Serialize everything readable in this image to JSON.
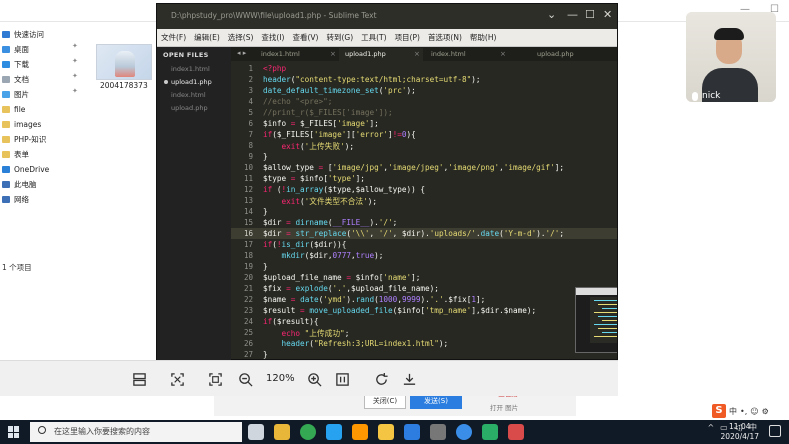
{
  "explorer": {
    "nav": [
      {
        "label": "快速访问",
        "color": "#2f7bd3",
        "pinned": false
      },
      {
        "label": "桌面",
        "color": "#3a8fe0",
        "pinned": true
      },
      {
        "label": "下载",
        "color": "#2e8de0",
        "pinned": true
      },
      {
        "label": "文档",
        "color": "#9aa6b2",
        "pinned": true
      },
      {
        "label": "图片",
        "color": "#4aa3e8",
        "pinned": true
      },
      {
        "label": "file",
        "color": "#e8c25a",
        "pinned": false
      },
      {
        "label": "images",
        "color": "#e8c25a",
        "pinned": false
      },
      {
        "label": "PHP-知识",
        "color": "#e8c25a",
        "pinned": false
      },
      {
        "label": "表单",
        "color": "#e8c25a",
        "pinned": false
      },
      {
        "label": "OneDrive",
        "color": "#2a7fd6",
        "pinned": false
      },
      {
        "label": "此电脑",
        "color": "#3d6fb6",
        "pinned": false
      },
      {
        "label": "网络",
        "color": "#3d6fb6",
        "pinned": false
      }
    ],
    "thumbnail_label": "2004178373",
    "status": "1 个项目",
    "dialog": {
      "close_label": "关闭(C)",
      "send_label": "发送(S)",
      "chip_top": "06主石路",
      "chip_bottom": "打开 图片"
    }
  },
  "sublime": {
    "title": "D:\\phpstudy_pro\\WWW\\file\\upload1.php - Sublime Text",
    "menu": [
      "文件(F)",
      "编辑(E)",
      "选择(S)",
      "查找(I)",
      "查看(V)",
      "转到(G)",
      "工具(T)",
      "项目(P)",
      "首选项(N)",
      "帮助(H)"
    ],
    "sidebar_header": "OPEN FILES",
    "open_files": [
      "index1.html",
      "upload1.php",
      "index.html",
      "upload.php"
    ],
    "tabs": [
      "index1.html",
      "upload1.php",
      "index.html",
      "upload.php"
    ],
    "current_line": 16,
    "code": [
      {
        "n": "1",
        "html": "<span style=\"color:#f92672\">&lt;?php</span>"
      },
      {
        "n": "2",
        "html": "<span style=\"color:#66d9ef\">header</span>(<span style=\"color:#e6db74\">\"content-type:text/html;charset=utf-8\"</span>);"
      },
      {
        "n": "3",
        "html": "<span style=\"color:#66d9ef\">date_default_timezone_set</span>(<span style=\"color:#e6db74\">'prc'</span>);"
      },
      {
        "n": "4",
        "html": "<span style=\"color:#75715e\">//echo \"&lt;pre&gt;\";</span>"
      },
      {
        "n": "5",
        "html": "<span style=\"color:#75715e\">//print_r($_FILES['image']);</span>"
      },
      {
        "n": "6",
        "html": "$info <span style=\"color:#f92672\">=</span> $_FILES[<span style=\"color:#e6db74\">'image'</span>];"
      },
      {
        "n": "7",
        "html": "<span style=\"color:#f92672\">if</span>($_FILES[<span style=\"color:#e6db74\">'image'</span>][<span style=\"color:#e6db74\">'error'</span>]<span style=\"color:#f92672\">!=</span><span style=\"color:#ae81ff\">0</span>){"
      },
      {
        "n": "8",
        "html": "    <span style=\"color:#f92672\">exit</span>(<span style=\"color:#e6db74\">'上传失败'</span>);"
      },
      {
        "n": "9",
        "html": "}"
      },
      {
        "n": "10",
        "html": "$allow_type <span style=\"color:#f92672\">=</span> [<span style=\"color:#e6db74\">'image/jpg'</span>,<span style=\"color:#e6db74\">'image/jpeg'</span>,<span style=\"color:#e6db74\">'image/png'</span>,<span style=\"color:#e6db74\">'image/gif'</span>];"
      },
      {
        "n": "11",
        "html": "$type <span style=\"color:#f92672\">=</span> $info[<span style=\"color:#e6db74\">'type'</span>];"
      },
      {
        "n": "12",
        "html": "<span style=\"color:#f92672\">if</span> (<span style=\"color:#f92672\">!</span><span style=\"color:#66d9ef\">in_array</span>($type,$allow_type)) {"
      },
      {
        "n": "13",
        "html": "    <span style=\"color:#f92672\">exit</span>(<span style=\"color:#e6db74\">'文件类型不合法'</span>);"
      },
      {
        "n": "14",
        "html": "}"
      },
      {
        "n": "15",
        "html": "$dir <span style=\"color:#f92672\">=</span> <span style=\"color:#66d9ef\">dirname</span>(<span style=\"color:#ae81ff\">__FILE__</span>).<span style=\"color:#e6db74\">'/'</span>;"
      },
      {
        "n": "16",
        "html": "$dir <span style=\"color:#f92672\">=</span> <span style=\"color:#66d9ef\">str_replace</span>(<span style=\"color:#e6db74\">'\\\\'</span>, <span style=\"color:#e6db74\">'/'</span>, $dir).<span style=\"color:#e6db74\">'uploads/'</span>.<span style=\"color:#66d9ef\">date</span>(<span style=\"color:#e6db74\">'Y-m-d'</span>).<span style=\"color:#e6db74\">'/'</span>;"
      },
      {
        "n": "17",
        "html": "<span style=\"color:#f92672\">if</span>(<span style=\"color:#f92672\">!</span><span style=\"color:#66d9ef\">is_dir</span>($dir)){"
      },
      {
        "n": "18",
        "html": "    <span style=\"color:#66d9ef\">mkdir</span>($dir,<span style=\"color:#ae81ff\">0777</span>,<span style=\"color:#ae81ff\">true</span>);"
      },
      {
        "n": "19",
        "html": "}"
      },
      {
        "n": "20",
        "html": "$upload_file_name <span style=\"color:#f92672\">=</span> $info[<span style=\"color:#e6db74\">'name'</span>];"
      },
      {
        "n": "21",
        "html": "$fix <span style=\"color:#f92672\">=</span> <span style=\"color:#66d9ef\">explode</span>(<span style=\"color:#e6db74\">'.'</span>,$upload_file_name);"
      },
      {
        "n": "22",
        "html": "$name <span style=\"color:#f92672\">=</span> <span style=\"color:#66d9ef\">date</span>(<span style=\"color:#e6db74\">'ymd'</span>).<span style=\"color:#66d9ef\">rand</span>(<span style=\"color:#ae81ff\">1000</span>,<span style=\"color:#ae81ff\">9999</span>).<span style=\"color:#e6db74\">'.'</span>.$fix[<span style=\"color:#ae81ff\">1</span>];"
      },
      {
        "n": "23",
        "html": "$result <span style=\"color:#f92672\">=</span> <span style=\"color:#66d9ef\">move_uploaded_file</span>($info[<span style=\"color:#e6db74\">'tmp_name'</span>],$dir.$name);"
      },
      {
        "n": "24",
        "html": "<span style=\"color:#f92672\">if</span>($result){"
      },
      {
        "n": "25",
        "html": "    <span style=\"color:#f92672\">echo</span> <span style=\"color:#e6db74\">\"上传成功\"</span>;"
      },
      {
        "n": "26",
        "html": "    <span style=\"color:#66d9ef\">header</span>(<span style=\"color:#e6db74\">\"Refresh:3;URL=index1.html\"</span>);"
      },
      {
        "n": "27",
        "html": "}"
      }
    ]
  },
  "viewer": {
    "zoom": "120%"
  },
  "webcam": {
    "name": "nick"
  },
  "taskbar": {
    "search_placeholder": "在这里输入你要搜索的内容",
    "time": "11:04",
    "date": "2020/4/17",
    "apps": [
      {
        "name": "task-view",
        "color": "#cfd6de"
      },
      {
        "name": "explorer",
        "color": "#e8b73a"
      },
      {
        "name": "chrome",
        "color": "#34a853"
      },
      {
        "name": "qq",
        "color": "#27a2f0"
      },
      {
        "name": "sublime",
        "color": "#ff9800"
      },
      {
        "name": "folder",
        "color": "#f4c542"
      },
      {
        "name": "photos",
        "color": "#2d7de0"
      },
      {
        "name": "media",
        "color": "#777777"
      },
      {
        "name": "meeting",
        "color": "#3b8ee8"
      },
      {
        "name": "wechat",
        "color": "#2aae67"
      },
      {
        "name": "app",
        "color": "#d94a4a"
      }
    ]
  },
  "ime": {
    "mode": "中"
  }
}
